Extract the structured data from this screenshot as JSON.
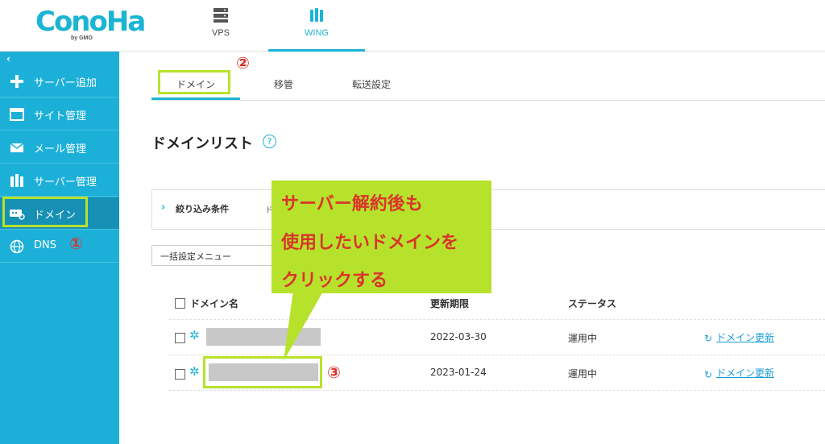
{
  "header": {
    "logo_text": "ConoHa",
    "logo_sub": "by GMO",
    "tabs": [
      {
        "label": "VPS",
        "icon": "server-icon"
      },
      {
        "label": "WING",
        "icon": "wing-server-icon",
        "active": true
      }
    ],
    "accent_color": "#1bb4d3"
  },
  "sidebar": {
    "collapse_label": "‹",
    "items": [
      {
        "label": "サーバー追加",
        "icon": "plus-icon"
      },
      {
        "label": "サイト管理",
        "icon": "window-icon"
      },
      {
        "label": "メール管理",
        "icon": "mail-icon"
      },
      {
        "label": "サーバー管理",
        "icon": "server-stack-icon"
      },
      {
        "label": "ドメイン",
        "icon": "domain-icon",
        "active": true
      },
      {
        "label": "DNS",
        "icon": "globe-icon"
      }
    ],
    "bg_color": "#1cb0d8"
  },
  "annotations": {
    "marker_1": "①",
    "marker_2": "②",
    "marker_3": "③",
    "callout_lines": [
      "サーバー解約後も",
      "使用したいドメインを",
      "クリックする"
    ],
    "highlight_color": "#b7e22c"
  },
  "subtabs": [
    "ドメイン",
    "移管",
    "転送設定"
  ],
  "page_title": "ドメインリスト",
  "help_label": "?",
  "filter": {
    "label": "絞り込み条件",
    "extra": "ド"
  },
  "bulk_menu": "一括設定メニュー",
  "table": {
    "headers": [
      "ドメイン名",
      "更新期限",
      "ステータス"
    ],
    "rows": [
      {
        "expiry": "2022-03-30",
        "status": "運用中",
        "action": "ドメイン更新"
      },
      {
        "expiry": "2023-01-24",
        "status": "運用中",
        "action": "ドメイン更新"
      }
    ]
  }
}
